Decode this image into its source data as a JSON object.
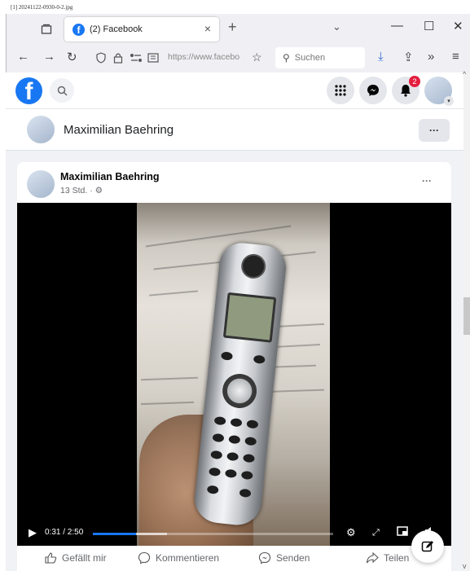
{
  "image_caption": "[1] 20241122-0930-0-2.jpg",
  "browser": {
    "tab_title": "(2) Facebook",
    "url": "https://www.facebo",
    "search_placeholder": "Suchen",
    "icons": {
      "tab_list": "tab-list-icon",
      "tab_close": "×",
      "new_tab": "+",
      "tab_menu": "⌄",
      "minimize": "—",
      "maximize": "☐",
      "close": "✕",
      "back": "←",
      "forward": "→",
      "reload": "↻",
      "downloads": "⤓",
      "share": "⇪",
      "more_tools": "»",
      "menu": "≡",
      "bookmark": "☆"
    }
  },
  "facebook": {
    "notification_count": "2",
    "profile_name": "Maximilian Baehring",
    "more_label": "···",
    "post": {
      "author": "Maximilian Baehring",
      "time": "13 Std. · ⚙",
      "more_label": "···",
      "video": {
        "timecode": "0:31 / 2:50",
        "progress_fraction": 0.18,
        "buffered_fraction": 0.31
      },
      "actions": {
        "like": "Gefällt mir",
        "comment": "Kommentieren",
        "send": "Senden",
        "share": "Teilen"
      }
    }
  }
}
